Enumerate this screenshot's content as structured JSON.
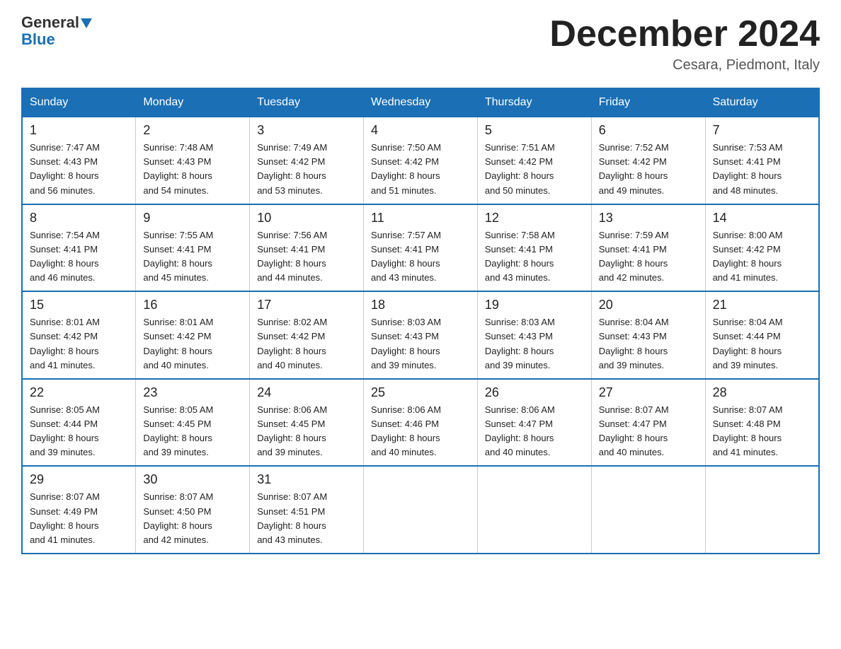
{
  "header": {
    "logo_general": "General",
    "logo_blue": "Blue",
    "month_title": "December 2024",
    "location": "Cesara, Piedmont, Italy"
  },
  "days_of_week": [
    "Sunday",
    "Monday",
    "Tuesday",
    "Wednesday",
    "Thursday",
    "Friday",
    "Saturday"
  ],
  "weeks": [
    [
      {
        "day": "1",
        "sunrise": "7:47 AM",
        "sunset": "4:43 PM",
        "daylight": "8 hours and 56 minutes."
      },
      {
        "day": "2",
        "sunrise": "7:48 AM",
        "sunset": "4:43 PM",
        "daylight": "8 hours and 54 minutes."
      },
      {
        "day": "3",
        "sunrise": "7:49 AM",
        "sunset": "4:42 PM",
        "daylight": "8 hours and 53 minutes."
      },
      {
        "day": "4",
        "sunrise": "7:50 AM",
        "sunset": "4:42 PM",
        "daylight": "8 hours and 51 minutes."
      },
      {
        "day": "5",
        "sunrise": "7:51 AM",
        "sunset": "4:42 PM",
        "daylight": "8 hours and 50 minutes."
      },
      {
        "day": "6",
        "sunrise": "7:52 AM",
        "sunset": "4:42 PM",
        "daylight": "8 hours and 49 minutes."
      },
      {
        "day": "7",
        "sunrise": "7:53 AM",
        "sunset": "4:41 PM",
        "daylight": "8 hours and 48 minutes."
      }
    ],
    [
      {
        "day": "8",
        "sunrise": "7:54 AM",
        "sunset": "4:41 PM",
        "daylight": "8 hours and 46 minutes."
      },
      {
        "day": "9",
        "sunrise": "7:55 AM",
        "sunset": "4:41 PM",
        "daylight": "8 hours and 45 minutes."
      },
      {
        "day": "10",
        "sunrise": "7:56 AM",
        "sunset": "4:41 PM",
        "daylight": "8 hours and 44 minutes."
      },
      {
        "day": "11",
        "sunrise": "7:57 AM",
        "sunset": "4:41 PM",
        "daylight": "8 hours and 43 minutes."
      },
      {
        "day": "12",
        "sunrise": "7:58 AM",
        "sunset": "4:41 PM",
        "daylight": "8 hours and 43 minutes."
      },
      {
        "day": "13",
        "sunrise": "7:59 AM",
        "sunset": "4:41 PM",
        "daylight": "8 hours and 42 minutes."
      },
      {
        "day": "14",
        "sunrise": "8:00 AM",
        "sunset": "4:42 PM",
        "daylight": "8 hours and 41 minutes."
      }
    ],
    [
      {
        "day": "15",
        "sunrise": "8:01 AM",
        "sunset": "4:42 PM",
        "daylight": "8 hours and 41 minutes."
      },
      {
        "day": "16",
        "sunrise": "8:01 AM",
        "sunset": "4:42 PM",
        "daylight": "8 hours and 40 minutes."
      },
      {
        "day": "17",
        "sunrise": "8:02 AM",
        "sunset": "4:42 PM",
        "daylight": "8 hours and 40 minutes."
      },
      {
        "day": "18",
        "sunrise": "8:03 AM",
        "sunset": "4:43 PM",
        "daylight": "8 hours and 39 minutes."
      },
      {
        "day": "19",
        "sunrise": "8:03 AM",
        "sunset": "4:43 PM",
        "daylight": "8 hours and 39 minutes."
      },
      {
        "day": "20",
        "sunrise": "8:04 AM",
        "sunset": "4:43 PM",
        "daylight": "8 hours and 39 minutes."
      },
      {
        "day": "21",
        "sunrise": "8:04 AM",
        "sunset": "4:44 PM",
        "daylight": "8 hours and 39 minutes."
      }
    ],
    [
      {
        "day": "22",
        "sunrise": "8:05 AM",
        "sunset": "4:44 PM",
        "daylight": "8 hours and 39 minutes."
      },
      {
        "day": "23",
        "sunrise": "8:05 AM",
        "sunset": "4:45 PM",
        "daylight": "8 hours and 39 minutes."
      },
      {
        "day": "24",
        "sunrise": "8:06 AM",
        "sunset": "4:45 PM",
        "daylight": "8 hours and 39 minutes."
      },
      {
        "day": "25",
        "sunrise": "8:06 AM",
        "sunset": "4:46 PM",
        "daylight": "8 hours and 40 minutes."
      },
      {
        "day": "26",
        "sunrise": "8:06 AM",
        "sunset": "4:47 PM",
        "daylight": "8 hours and 40 minutes."
      },
      {
        "day": "27",
        "sunrise": "8:07 AM",
        "sunset": "4:47 PM",
        "daylight": "8 hours and 40 minutes."
      },
      {
        "day": "28",
        "sunrise": "8:07 AM",
        "sunset": "4:48 PM",
        "daylight": "8 hours and 41 minutes."
      }
    ],
    [
      {
        "day": "29",
        "sunrise": "8:07 AM",
        "sunset": "4:49 PM",
        "daylight": "8 hours and 41 minutes."
      },
      {
        "day": "30",
        "sunrise": "8:07 AM",
        "sunset": "4:50 PM",
        "daylight": "8 hours and 42 minutes."
      },
      {
        "day": "31",
        "sunrise": "8:07 AM",
        "sunset": "4:51 PM",
        "daylight": "8 hours and 43 minutes."
      },
      null,
      null,
      null,
      null
    ]
  ],
  "labels": {
    "sunrise": "Sunrise:",
    "sunset": "Sunset:",
    "daylight": "Daylight:"
  }
}
